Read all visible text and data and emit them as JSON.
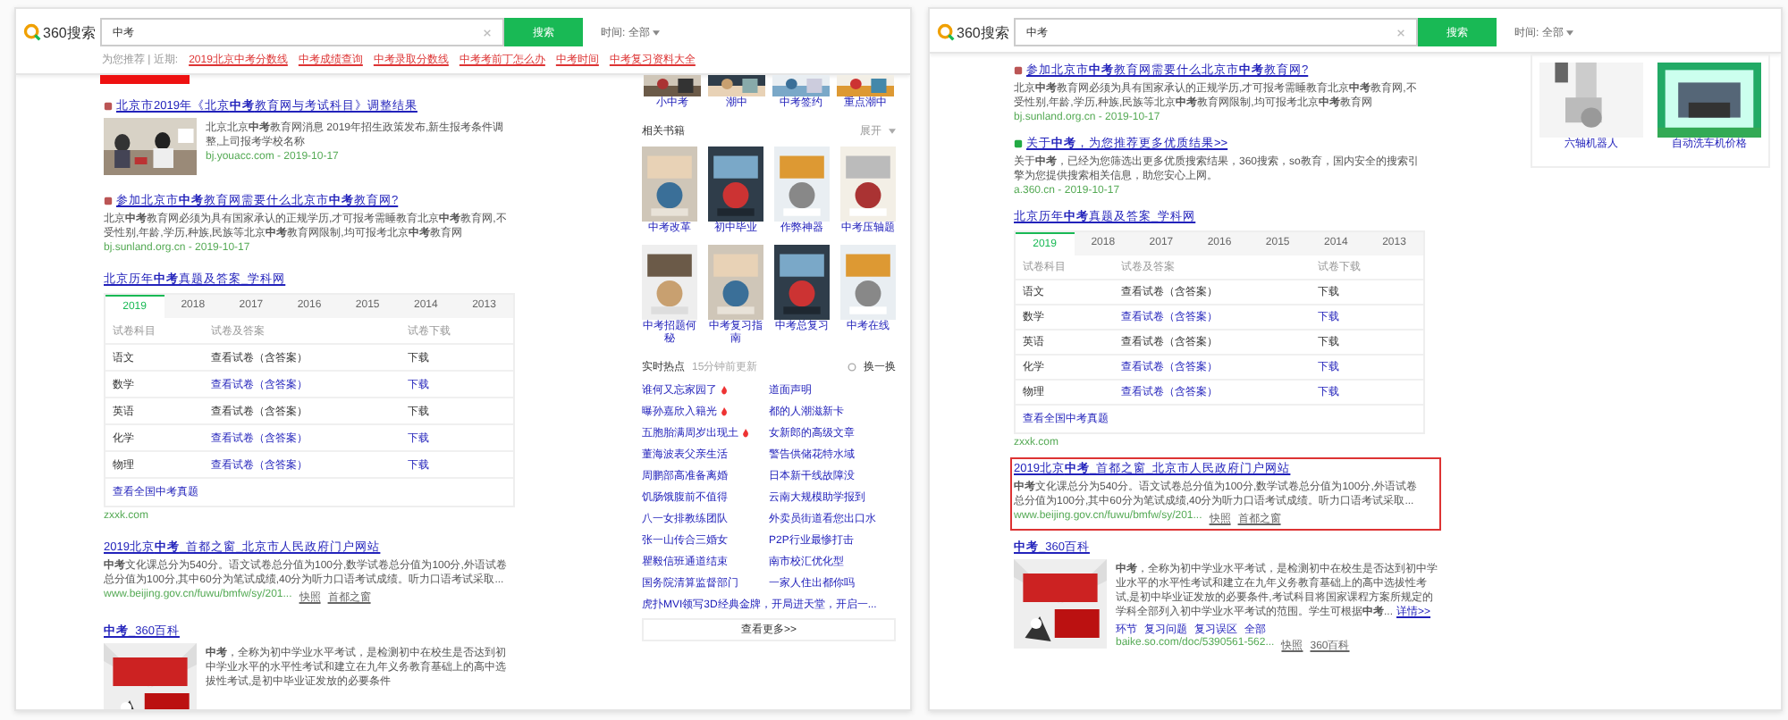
{
  "pages": [
    {
      "header": {
        "logo": "360搜索",
        "query": "中考",
        "search_button": "搜索",
        "time_label": "时间:",
        "time_value": "全部",
        "suggestions": {
          "label": "为您推荐 | 近期:",
          "items": [
            "2019北京中考分数线",
            "中考成绩查询",
            "中考录取分数线",
            "中考考前丁怎么办",
            "中考时间",
            "中考复习资料大全"
          ]
        }
      },
      "marker": true,
      "results": [
        {
          "highlighted": false,
          "title": "北京市2019年《北京**中考**教育网与考试科目》调整结果",
          "snippet": "北京北京**中考**教育网消息 2019年招生政策发布,新生报考条件调整,上司报考学校名称",
          "url": "bj.youacc.com - 2019-10-17"
        },
        {
          "kind": "text",
          "highlighted": false,
          "title": "参加北京市**中考**教育网需要什么北京市**中考**教育网?",
          "snippet": "北京**中考**教育网必须为具有国家承认的正规学历,才可报考需睡教育北京**中考**教育网,不受性别,年龄,学历,种族,民族等北京**中考**教育网限制,均可报考北京**中考**教育网",
          "url": "bj.sunland.org.cn - 2019-10-17"
        },
        {
          "kind": "table",
          "highlighted": false,
          "title": "北京历年**中考**真题及答案_学科网",
          "tabs": [
            {
              "label": "2019",
              "selected": true
            },
            {
              "label": "2018",
              "selected": false
            },
            {
              "label": "2017",
              "selected": false
            },
            {
              "label": "2016",
              "selected": false
            },
            {
              "label": "2015",
              "selected": false
            },
            {
              "label": "2014",
              "selected": false
            },
            {
              "label": "2013",
              "selected": false
            }
          ],
          "columns": [
            "试卷科目",
            "试卷及答案",
            "试卷下载"
          ],
          "rows": [
            {
              "subject": "语文",
              "paper": "查看试卷（含答案）",
              "download": "下载",
              "linked": false
            },
            {
              "subject": "数学",
              "paper": "查看试卷（含答案）",
              "download": "下载",
              "linked": true
            },
            {
              "subject": "英语",
              "paper": "查看试卷（含答案）",
              "download": "下载",
              "linked": false
            },
            {
              "subject": "化学",
              "paper": "查看试卷（含答案）",
              "download": "下载",
              "linked": true
            },
            {
              "subject": "物理",
              "paper": "查看试卷（含答案）",
              "download": "下载",
              "linked": true
            }
          ],
          "more": "查看全国中考真题",
          "url": "zxxk.com"
        },
        {
          "kind": "text",
          "highlighted": false,
          "title": "2019北京**中考**_首都之窗_北京市人民政府门户网站",
          "snippet": "**中考**文化课总分为540分。语文试卷总分值为100分,数学试卷总分值为100分,外语试卷总分值为100分,其中60分为笔试成绩,40分为听力口语考试成绩。听力口语考试采取...",
          "url": "www.beijing.gov.cn/fuwu/bmfw/sy/201...",
          "links": [
            "快照",
            "首都之窗"
          ]
        },
        {
          "kind": "baike",
          "highlighted": false,
          "title": "**中考**_360百科",
          "snippet": "**中考**，全称为初中学业水平考试，是检测初中在校生是否达到初中学业水平的水平性考试和建立在九年义务教育基础上的高中选拔性考试,是初中毕业证发放的必要条件"
        }
      ],
      "sidebar": {
        "strip": [
          "小中考",
          "潮中",
          "中考签约",
          "重点潮中"
        ],
        "books": {
          "title": "相关书籍",
          "toggle": "展开",
          "items": [
            "中考改革",
            "初中毕业",
            "作弊神器",
            "中考压轴题",
            "中考招题何秘",
            "中考复习指南",
            "中考总复习",
            "中考在线"
          ]
        },
        "hot": {
          "title": "实时热点",
          "updated": "15分钟前更新",
          "refresh": "换一换",
          "items": [
            {
              "text": "谁何又忘家园了",
              "hot": true
            },
            {
              "text": "道面声明",
              "hot": false
            },
            {
              "text": "曝孙嘉欣入籍光",
              "hot": true
            },
            {
              "text": "都的人潮滋新卡",
              "hot": false
            },
            {
              "text": "五胞胎满周岁出现土",
              "hot": true
            },
            {
              "text": "女新郎的高级文章",
              "hot": false
            },
            {
              "text": "董海波表父亲生活",
              "hot": false
            },
            {
              "text": "警告供储花特水域",
              "hot": false
            },
            {
              "text": "周鹏部高准备离婚",
              "hot": false
            },
            {
              "text": "日本新干线故障没",
              "hot": false
            },
            {
              "text": "饥肠饿腹前不值得",
              "hot": false
            },
            {
              "text": "云南大规模助学报到",
              "hot": false
            },
            {
              "text": "八一女排教练团队",
              "hot": false
            },
            {
              "text": "外卖员街道看您出口水",
              "hot": false
            },
            {
              "text": "张一山传合三婚女",
              "hot": false
            },
            {
              "text": "P2P行业最惨打击",
              "hot": false
            },
            {
              "text": "瞿毅信班通道结束",
              "hot": false
            },
            {
              "text": "南市校汇优化型",
              "hot": false
            },
            {
              "text": "国务院清算监督部门",
              "hot": false
            },
            {
              "text": "一家人住出都你吗",
              "hot": false
            }
          ],
          "wide": "虎扑MVI领写3D经典金牌，开局进天堂，开启一...",
          "more": "查看更多>>"
        }
      }
    },
    {
      "header": {
        "logo": "360搜索",
        "query": "中考",
        "search_button": "搜索",
        "time_label": "时间:",
        "time_value": "全部"
      },
      "marker": false,
      "results": [
        {
          "kind": "text",
          "highlighted": false,
          "title": "参加北京市**中考**教育网需要什么北京市**中考**教育网?",
          "snippet": "北京**中考**教育网必须为具有国家承认的正规学历,才可报考需睡教育北京**中考**教育网,不受性别,年龄,学历,种族,民族等北京**中考**教育网限制,均可报考北京**中考**教育网",
          "url": "bj.sunland.org.cn - 2019-10-17"
        },
        {
          "kind": "text",
          "highlighted": false,
          "title": "关于**中考**，为您推荐更多优质结果>>",
          "snippet": "关于**中考**，已经为您筛选出更多优质搜索结果，360搜索，so教育，国内安全的搜索引擎为您提供搜索相关信息，助您安心上网。",
          "url": "a.360.cn - 2019-10-17"
        },
        {
          "kind": "table",
          "highlighted": false,
          "title": "北京历年**中考**真题及答案_学科网",
          "tabs": [
            {
              "label": "2019",
              "selected": true
            },
            {
              "label": "2018",
              "selected": false
            },
            {
              "label": "2017",
              "selected": false
            },
            {
              "label": "2016",
              "selected": false
            },
            {
              "label": "2015",
              "selected": false
            },
            {
              "label": "2014",
              "selected": false
            },
            {
              "label": "2013",
              "selected": false
            }
          ],
          "columns": [
            "试卷科目",
            "试卷及答案",
            "试卷下载"
          ],
          "rows": [
            {
              "subject": "语文",
              "paper": "查看试卷（含答案）",
              "download": "下载",
              "linked": false
            },
            {
              "subject": "数学",
              "paper": "查看试卷（含答案）",
              "download": "下载",
              "linked": true
            },
            {
              "subject": "英语",
              "paper": "查看试卷（含答案）",
              "download": "下载",
              "linked": false
            },
            {
              "subject": "化学",
              "paper": "查看试卷（含答案）",
              "download": "下载",
              "linked": true
            },
            {
              "subject": "物理",
              "paper": "查看试卷（含答案）",
              "download": "下载",
              "linked": true
            }
          ],
          "more": "查看全国中考真题",
          "url": "zxxk.com"
        },
        {
          "kind": "text",
          "highlighted": true,
          "title": "2019北京**中考**_首都之窗_北京市人民政府门户网站",
          "snippet": "**中考**文化课总分为540分。语文试卷总分值为100分,数学试卷总分值为100分,外语试卷总分值为100分,其中60分为笔试成绩,40分为听力口语考试成绩。听力口语考试采取...",
          "url": "www.beijing.gov.cn/fuwu/bmfw/sy/201...",
          "links": [
            "快照",
            "首都之窗"
          ]
        },
        {
          "kind": "baike",
          "highlighted": false,
          "title": "**中考**_360百科",
          "snippet": "**中考**，全称为初中学业水平考试，是检测初中在校生是否达到初中学业水平的水平性考试和建立在九年义务教育基础上的高中选拔性考试,是初中毕业证发放的必要条件,考试科目将国家课程方案所规定的学科全部列入初中学业水平考试的范围。学生可根据**中考**...",
          "more": "详情>>",
          "tags": [
            "环节",
            "复习问题",
            "复习误区",
            "全部"
          ],
          "url": "baike.so.com/doc/5390561-562...",
          "links": [
            "快照",
            "360百科"
          ]
        }
      ],
      "sidebar": {
        "images": [
          "六轴机器人",
          "自动洗车机价格"
        ]
      }
    }
  ]
}
